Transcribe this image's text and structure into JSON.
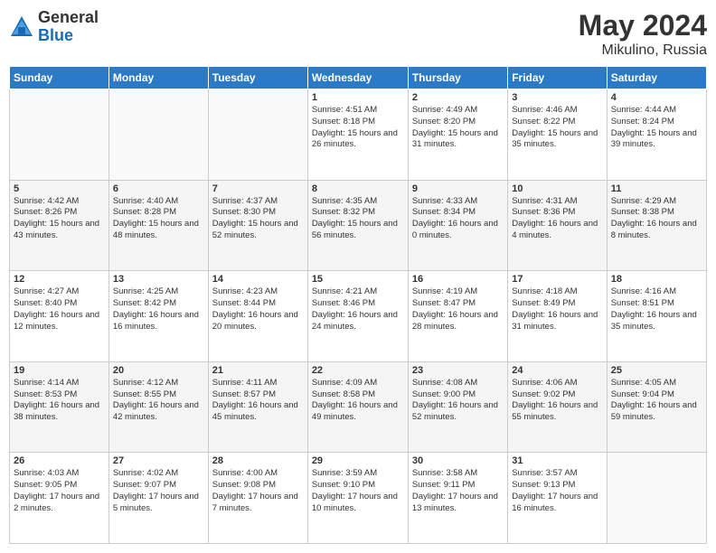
{
  "header": {
    "logo_general": "General",
    "logo_blue": "Blue",
    "title": "May 2024",
    "subtitle": "Mikulino, Russia"
  },
  "columns": [
    "Sunday",
    "Monday",
    "Tuesday",
    "Wednesday",
    "Thursday",
    "Friday",
    "Saturday"
  ],
  "rows": [
    [
      {
        "day": "",
        "content": ""
      },
      {
        "day": "",
        "content": ""
      },
      {
        "day": "",
        "content": ""
      },
      {
        "day": "1",
        "content": "Sunrise: 4:51 AM\nSunset: 8:18 PM\nDaylight: 15 hours\nand 26 minutes."
      },
      {
        "day": "2",
        "content": "Sunrise: 4:49 AM\nSunset: 8:20 PM\nDaylight: 15 hours\nand 31 minutes."
      },
      {
        "day": "3",
        "content": "Sunrise: 4:46 AM\nSunset: 8:22 PM\nDaylight: 15 hours\nand 35 minutes."
      },
      {
        "day": "4",
        "content": "Sunrise: 4:44 AM\nSunset: 8:24 PM\nDaylight: 15 hours\nand 39 minutes."
      }
    ],
    [
      {
        "day": "5",
        "content": "Sunrise: 4:42 AM\nSunset: 8:26 PM\nDaylight: 15 hours\nand 43 minutes."
      },
      {
        "day": "6",
        "content": "Sunrise: 4:40 AM\nSunset: 8:28 PM\nDaylight: 15 hours\nand 48 minutes."
      },
      {
        "day": "7",
        "content": "Sunrise: 4:37 AM\nSunset: 8:30 PM\nDaylight: 15 hours\nand 52 minutes."
      },
      {
        "day": "8",
        "content": "Sunrise: 4:35 AM\nSunset: 8:32 PM\nDaylight: 15 hours\nand 56 minutes."
      },
      {
        "day": "9",
        "content": "Sunrise: 4:33 AM\nSunset: 8:34 PM\nDaylight: 16 hours\nand 0 minutes."
      },
      {
        "day": "10",
        "content": "Sunrise: 4:31 AM\nSunset: 8:36 PM\nDaylight: 16 hours\nand 4 minutes."
      },
      {
        "day": "11",
        "content": "Sunrise: 4:29 AM\nSunset: 8:38 PM\nDaylight: 16 hours\nand 8 minutes."
      }
    ],
    [
      {
        "day": "12",
        "content": "Sunrise: 4:27 AM\nSunset: 8:40 PM\nDaylight: 16 hours\nand 12 minutes."
      },
      {
        "day": "13",
        "content": "Sunrise: 4:25 AM\nSunset: 8:42 PM\nDaylight: 16 hours\nand 16 minutes."
      },
      {
        "day": "14",
        "content": "Sunrise: 4:23 AM\nSunset: 8:44 PM\nDaylight: 16 hours\nand 20 minutes."
      },
      {
        "day": "15",
        "content": "Sunrise: 4:21 AM\nSunset: 8:46 PM\nDaylight: 16 hours\nand 24 minutes."
      },
      {
        "day": "16",
        "content": "Sunrise: 4:19 AM\nSunset: 8:47 PM\nDaylight: 16 hours\nand 28 minutes."
      },
      {
        "day": "17",
        "content": "Sunrise: 4:18 AM\nSunset: 8:49 PM\nDaylight: 16 hours\nand 31 minutes."
      },
      {
        "day": "18",
        "content": "Sunrise: 4:16 AM\nSunset: 8:51 PM\nDaylight: 16 hours\nand 35 minutes."
      }
    ],
    [
      {
        "day": "19",
        "content": "Sunrise: 4:14 AM\nSunset: 8:53 PM\nDaylight: 16 hours\nand 38 minutes."
      },
      {
        "day": "20",
        "content": "Sunrise: 4:12 AM\nSunset: 8:55 PM\nDaylight: 16 hours\nand 42 minutes."
      },
      {
        "day": "21",
        "content": "Sunrise: 4:11 AM\nSunset: 8:57 PM\nDaylight: 16 hours\nand 45 minutes."
      },
      {
        "day": "22",
        "content": "Sunrise: 4:09 AM\nSunset: 8:58 PM\nDaylight: 16 hours\nand 49 minutes."
      },
      {
        "day": "23",
        "content": "Sunrise: 4:08 AM\nSunset: 9:00 PM\nDaylight: 16 hours\nand 52 minutes."
      },
      {
        "day": "24",
        "content": "Sunrise: 4:06 AM\nSunset: 9:02 PM\nDaylight: 16 hours\nand 55 minutes."
      },
      {
        "day": "25",
        "content": "Sunrise: 4:05 AM\nSunset: 9:04 PM\nDaylight: 16 hours\nand 59 minutes."
      }
    ],
    [
      {
        "day": "26",
        "content": "Sunrise: 4:03 AM\nSunset: 9:05 PM\nDaylight: 17 hours\nand 2 minutes."
      },
      {
        "day": "27",
        "content": "Sunrise: 4:02 AM\nSunset: 9:07 PM\nDaylight: 17 hours\nand 5 minutes."
      },
      {
        "day": "28",
        "content": "Sunrise: 4:00 AM\nSunset: 9:08 PM\nDaylight: 17 hours\nand 7 minutes."
      },
      {
        "day": "29",
        "content": "Sunrise: 3:59 AM\nSunset: 9:10 PM\nDaylight: 17 hours\nand 10 minutes."
      },
      {
        "day": "30",
        "content": "Sunrise: 3:58 AM\nSunset: 9:11 PM\nDaylight: 17 hours\nand 13 minutes."
      },
      {
        "day": "31",
        "content": "Sunrise: 3:57 AM\nSunset: 9:13 PM\nDaylight: 17 hours\nand 16 minutes."
      },
      {
        "day": "",
        "content": ""
      }
    ]
  ]
}
